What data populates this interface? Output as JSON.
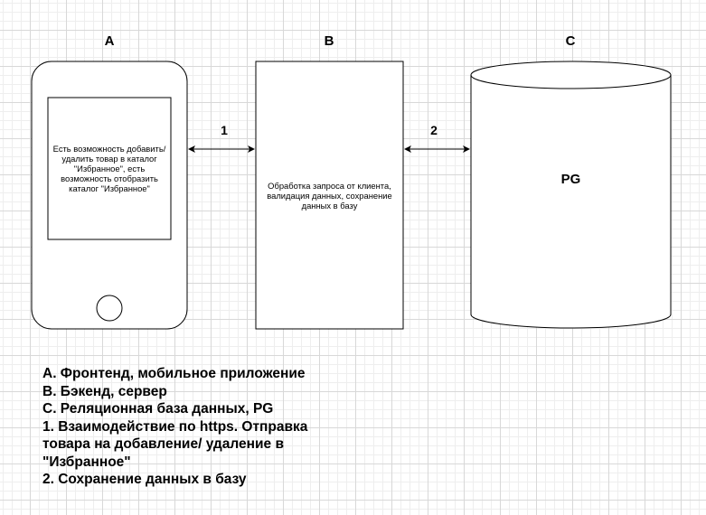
{
  "columns": {
    "a": "A",
    "b": "B",
    "c": "C"
  },
  "frontend": {
    "text": "Есть возможность добавить/ удалить товар в каталог \"Избранное\", есть возможность отобразить каталог \"Избранное\""
  },
  "backend": {
    "text": "Обработка запроса от клиента, валидация данных, сохранение данных в базу"
  },
  "database": {
    "text": "PG"
  },
  "connections": {
    "ab": "1",
    "bc": "2"
  },
  "legend": [
    "A. Фронтенд, мобильное приложение",
    "B. Бэкенд, сервер",
    "C. Реляционная база данных, PG",
    "1. Взаимодействие по https. Отправка товара на добавление/ удаление в \"Избранное\"",
    "2. Сохранение данных в базу"
  ]
}
